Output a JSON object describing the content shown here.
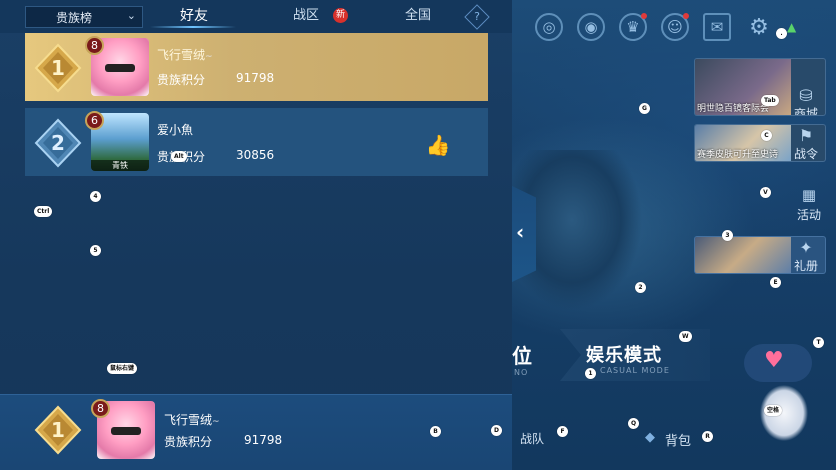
{
  "ranking": {
    "category_dropdown": "贵族榜",
    "tabs": [
      {
        "label": "好友",
        "active": true
      },
      {
        "label": "战区",
        "badge": "新"
      },
      {
        "label": "全国"
      }
    ],
    "help_label": "?",
    "rows": [
      {
        "rank": "1",
        "level": "8",
        "name": "飞行雪绒",
        "name_suffix": "~",
        "score_label": "贵族积分",
        "score": "91798"
      },
      {
        "rank": "2",
        "level": "6",
        "name": "爱小魚",
        "score_label": "贵族积分",
        "score": "30856",
        "avatar_caption": "青铁"
      }
    ],
    "my_row": {
      "rank": "1",
      "level": "8",
      "name": "飞行雪绒",
      "name_suffix": "~",
      "score_label": "贵族积分",
      "score": "91798"
    }
  },
  "collapse_arrow": "‹",
  "top_icons": [
    "target-icon",
    "eye-icon",
    "trophy-icon",
    "friends-icon",
    "mail-icon",
    "gear-icon",
    "wifi-icon"
  ],
  "side_cards": [
    {
      "caption": "明世隐百镜客际会",
      "label": "商城",
      "icon": "bag-icon"
    },
    {
      "caption": "赛季皮肤可升至史诗",
      "label": "战令",
      "icon": "flag-icon"
    },
    {
      "label": "活动",
      "icon": "calendar-icon"
    },
    {
      "label": "礼册",
      "icon": "star-icon"
    }
  ],
  "modes": {
    "ranked_partial": "位",
    "ranked_sub": "NO",
    "entertainment": "娱乐模式",
    "entertainment_sub": "CASUAL MODE"
  },
  "bottom_nav": {
    "team": "战队",
    "bag": "背包"
  },
  "key_hints": {
    "ctrl": "Ctrl",
    "alt": "Alt",
    "tab": "Tab",
    "right_mouse": "鼠标右键",
    "space": "空格",
    "g": "G",
    "c": "C",
    "v": "V",
    "e": "E",
    "w": "W",
    "t": "T",
    "q": "Q",
    "r": "R",
    "f": "F",
    "b": "B",
    "d": "D",
    "n1": "1",
    "n2": "2",
    "n3": "3",
    "n4": "4",
    "n5": "5",
    "dot": "."
  },
  "colors": {
    "gold_row": "#d9bd78",
    "blue_row": "#24537e",
    "accent": "#4aa6ff",
    "new_badge": "#d8312c"
  }
}
